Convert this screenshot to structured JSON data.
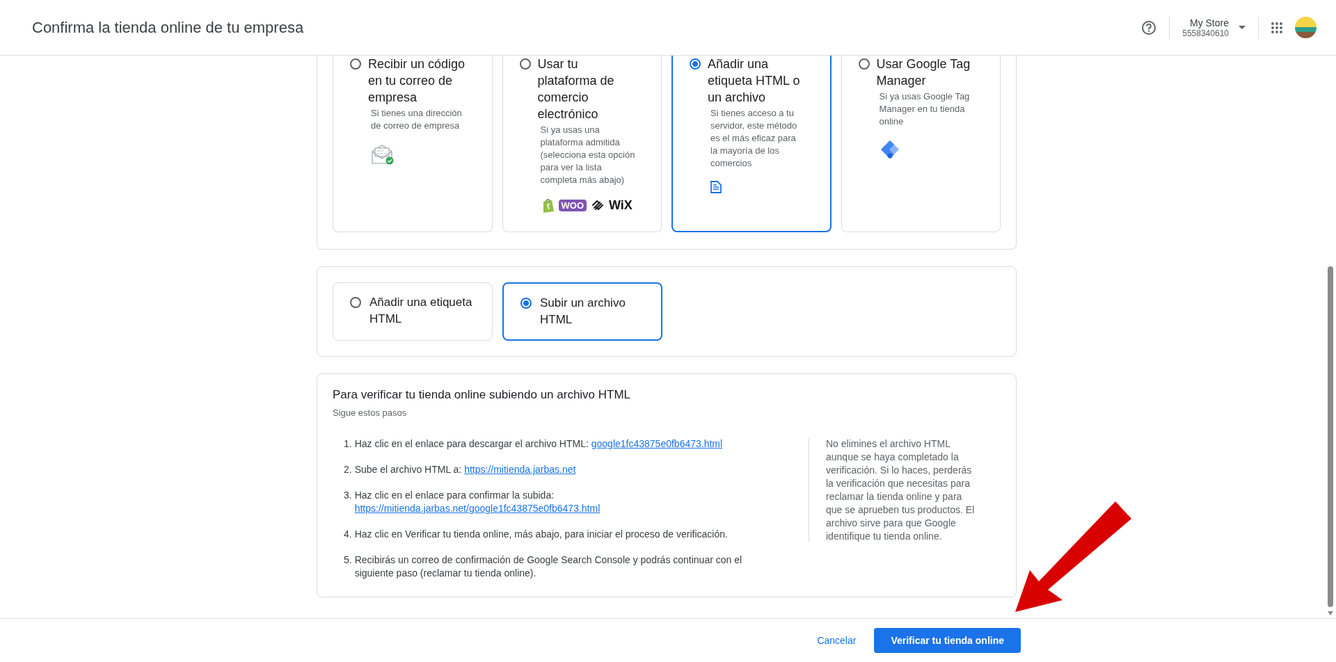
{
  "header": {
    "title": "Confirma la tienda online de tu empresa",
    "account_name": "My Store",
    "account_id": "5558340610"
  },
  "methods": [
    {
      "kind": "email",
      "title": "Recibir un código en tu correo de empresa",
      "description": "Si tienes una dirección de correo de empresa",
      "selected": false
    },
    {
      "kind": "platform",
      "title": "Usar tu plataforma de comercio electrónico",
      "description": "Si ya usas una plataforma admitida (selecciona esta opción para ver la lista completa más abajo)",
      "selected": false,
      "logos": [
        {
          "kind": "shopify"
        },
        {
          "kind": "woo",
          "text": "WOO"
        },
        {
          "kind": "squarespace"
        },
        {
          "kind": "wix",
          "text": "WiX"
        }
      ]
    },
    {
      "kind": "file",
      "title": "Añadir una etiqueta HTML o un archivo",
      "description": "Si tienes acceso a tu servidor, este método es el más eficaz para la mayoría de los comercios",
      "selected": true
    },
    {
      "kind": "tagmanager",
      "title": "Usar Google Tag Manager",
      "description": "Si ya usas Google Tag Manager en tu tienda online",
      "selected": false
    }
  ],
  "sub_options": [
    {
      "label": "Añadir una etiqueta HTML",
      "selected": false
    },
    {
      "label": "Subir un archivo HTML",
      "selected": true
    }
  ],
  "instructions": {
    "title": "Para verificar tu tienda online subiendo un archivo HTML",
    "subtitle": "Sigue estos pasos",
    "steps": [
      {
        "number": "1.",
        "text": "Haz clic en el enlace para descargar el archivo HTML:",
        "link": "google1fc43875e0fb6473.html"
      },
      {
        "number": "2.",
        "text": "Sube el archivo HTML a:",
        "link": "https://mitienda.jarbas.net"
      },
      {
        "number": "3.",
        "text": "Haz clic en el enlace para confirmar la subida:",
        "link": "https://mitienda.jarbas.net/google1fc43875e0fb6473.html"
      },
      {
        "number": "4.",
        "text": "Haz clic en Verificar tu tienda online, más abajo, para iniciar el proceso de verificación."
      },
      {
        "number": "5.",
        "text": "Recibirás un correo de confirmación de Google Search Console y podrás continuar con el siguiente paso (reclamar tu tienda online)."
      }
    ],
    "note": "No elimines el archivo HTML aunque se haya completado la verificación. Si lo haces, perderás la verificación que necesitas para reclamar la tienda online y para que se aprueben tus productos. El archivo sirve para que Google identifique tu tienda online."
  },
  "footer": {
    "cancel": "Cancelar",
    "confirm": "Verificar tu tienda online"
  }
}
